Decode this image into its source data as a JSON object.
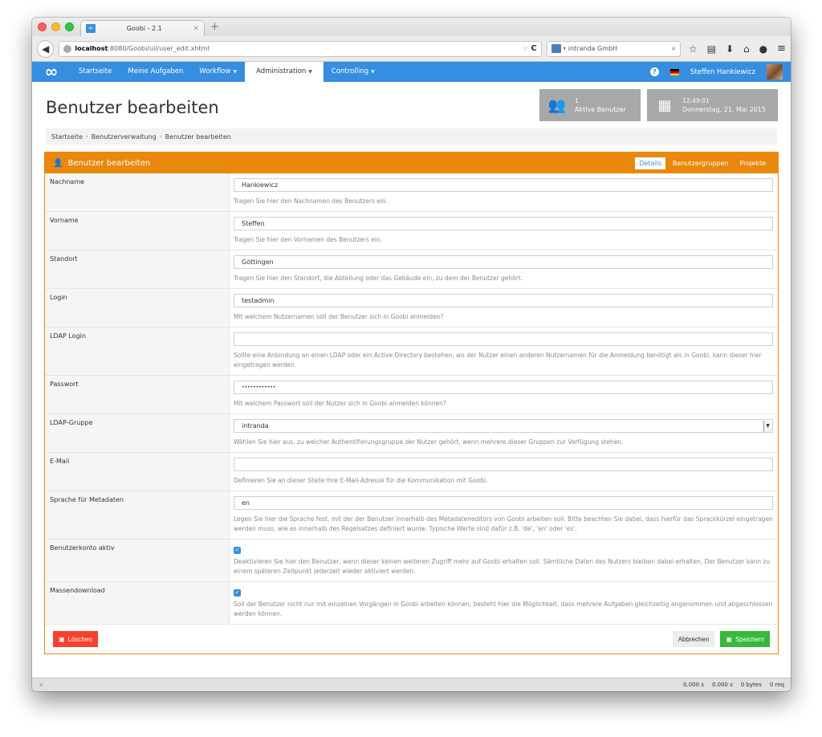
{
  "browser": {
    "tab_title": "Goobi - 2.1",
    "tab_favicon": "∞",
    "new_tab": "+",
    "url_host": "localhost",
    "url_rest": ":8080/Goobi/uii/user_edit.xhtml",
    "search_engine": "intranda GmbH",
    "icons": [
      "star-icon",
      "clipboard-icon",
      "download-icon",
      "home-icon",
      "chat-icon"
    ],
    "menu_icon": "≡"
  },
  "goobi_nav": {
    "logo": "∞",
    "items": [
      {
        "label": "Startseite",
        "dropdown": false,
        "active": false
      },
      {
        "label": "Meine Aufgaben",
        "dropdown": false,
        "active": false
      },
      {
        "label": "Workflow",
        "dropdown": true,
        "active": false
      },
      {
        "label": "Administration",
        "dropdown": true,
        "active": true
      },
      {
        "label": "Controlling",
        "dropdown": true,
        "active": false
      }
    ],
    "help": "?",
    "user_name": "Steffen Hankiewicz"
  },
  "header": {
    "title": "Benutzer bearbeiten",
    "active_users_count": "1",
    "active_users_label": "Aktive Benutzer",
    "time": "12:49:01",
    "date": "Donnerstag, 21. Mai 2015"
  },
  "breadcrumb": [
    "Startseite",
    "Benutzerverwaltung",
    "Benutzer bearbeiten"
  ],
  "breadcrumb_sep": "›",
  "box": {
    "title": "Benutzer bearbeiten",
    "tabs": [
      {
        "label": "Details",
        "active": true
      },
      {
        "label": "Benutzergruppen",
        "active": false
      },
      {
        "label": "Projekte",
        "active": false
      }
    ]
  },
  "form": {
    "nachname": {
      "label": "Nachname",
      "value": "Hankiewicz",
      "help": "Tragen Sie hier den Nachnamen des Benutzers ein."
    },
    "vorname": {
      "label": "Vorname",
      "value": "Steffen",
      "help": "Tragen Sie hier den Vornamen des Benutzers ein."
    },
    "standort": {
      "label": "Standort",
      "value": "Göttingen",
      "help": "Tragen Sie hier den Standort, die Abteilung oder das Gebäude ein, zu dem der Benutzer gehört."
    },
    "login": {
      "label": "Login",
      "value": "testadmin",
      "help": "Mit welchem Nutzernamen soll der Benutzer sich in Goobi anmelden?"
    },
    "ldap_login": {
      "label": "LDAP Login",
      "value": "",
      "help": "Sollte eine Anbindung an einen LDAP oder ein Active Directory bestehen, wo der Nutzer einen anderen Nutzernamen für die Anmeldung benötigt als in Goobi, kann dieser hier eingetragen werden."
    },
    "passwort": {
      "label": "Passwort",
      "value": "••••••••••••",
      "help": "Mit welchem Passwort soll der Nutzer sich in Goobi anmelden können?"
    },
    "ldap_gruppe": {
      "label": "LDAP-Gruppe",
      "value": "intranda",
      "help": "Wählen Sie hier aus, zu welcher Authentifierungsgruppe der Nutzer gehört, wenn mehrere dieser Gruppen zur Verfügung stehen."
    },
    "email": {
      "label": "E-Mail",
      "value": "",
      "help": "Definieren Sie an dieser Stelle Ihre E-Mail-Adresse für die Kommunikation mit Goobi."
    },
    "sprache": {
      "label": "Sprache für Metadaten",
      "value": "en",
      "help": "Legen Sie hier die Sprache fest, mit der der Benutzer innerhalb des Metadateneditors von Goobi arbeiten soll. Bitte beachten Sie dabei, dass hierfür das Sprackkürzel eingetragen werden muss, wie es innerhalb des Regelsatzes definiert wurde. Typische Werte sind dafür z.B. 'de', 'en' oder 'es'."
    },
    "konto_aktiv": {
      "label": "Benutzerkonto aktiv",
      "checked": true,
      "help": "Deaktivieren Sie hier den Benutzer, wenn dieser keinen weiteren Zugriff mehr auf Goobi erhalten soll. Sämtliche Daten des Nutzers bleiben dabei erhalten. Der Benutzer kann zu einem späteren Zeitpunkt jederzeit wieder aktiviert werden."
    },
    "massendownload": {
      "label": "Massendownload",
      "checked": true,
      "help": "Soll der Benutzer nicht nur mit einzelnen Vorgängen in Goobi arbeiten können, besteht hier die Möglichkeit, dass mehrere Aufgaben gleichzeitig angenommen und abgeschlossen werden können."
    }
  },
  "buttons": {
    "delete": "Löschen",
    "cancel": "Abbrechen",
    "save": "Speichern"
  },
  "colors": {
    "nav_blue": "#368ee0",
    "box_orange": "#e8880d",
    "danger_red": "#f5412f",
    "success_green": "#37b93b",
    "info_gray": "#a8a8a8"
  },
  "statusbar": {
    "close": "✕",
    "stats": [
      "0.000 s",
      "0.000 s",
      "0 bytes",
      "0 req"
    ]
  }
}
